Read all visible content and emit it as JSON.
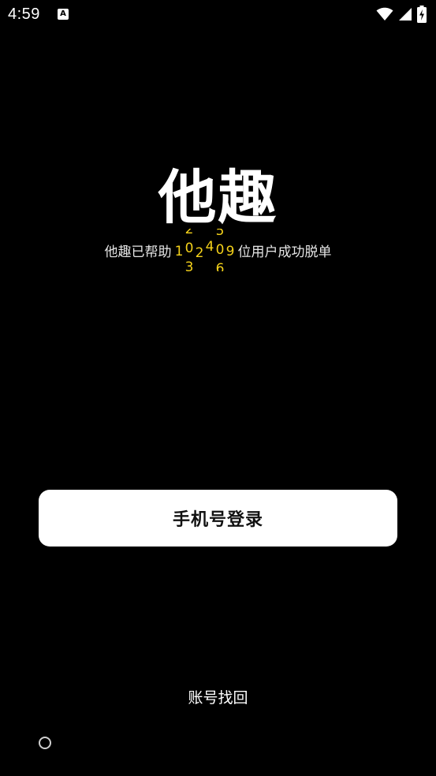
{
  "status_bar": {
    "time": "4:59",
    "notification_icon": "a-icon",
    "notification_letter": "A",
    "icons": [
      "wifi-icon",
      "signal-icon",
      "battery-charging-icon"
    ]
  },
  "app": {
    "logo_text": "他趣",
    "tagline_prefix": "他趣已帮助",
    "tagline_suffix": "位用户成功脱单",
    "counter_digits": [
      {
        "top": "",
        "mid": "1",
        "bot": ""
      },
      {
        "top": "2",
        "mid": "0",
        "bot": "3"
      },
      {
        "top": "",
        "mid": "2",
        "bot": ""
      },
      {
        "top": "",
        "mid": "4",
        "bot": ""
      },
      {
        "top": "5",
        "mid": "0",
        "bot": "6"
      },
      {
        "top": "",
        "mid": "9",
        "bot": ""
      }
    ]
  },
  "actions": {
    "phone_login_label": "手机号登录",
    "account_recovery_label": "账号找回"
  },
  "colors": {
    "background": "#000000",
    "button_bg": "#ffffff",
    "counter": "#f5d21a"
  }
}
